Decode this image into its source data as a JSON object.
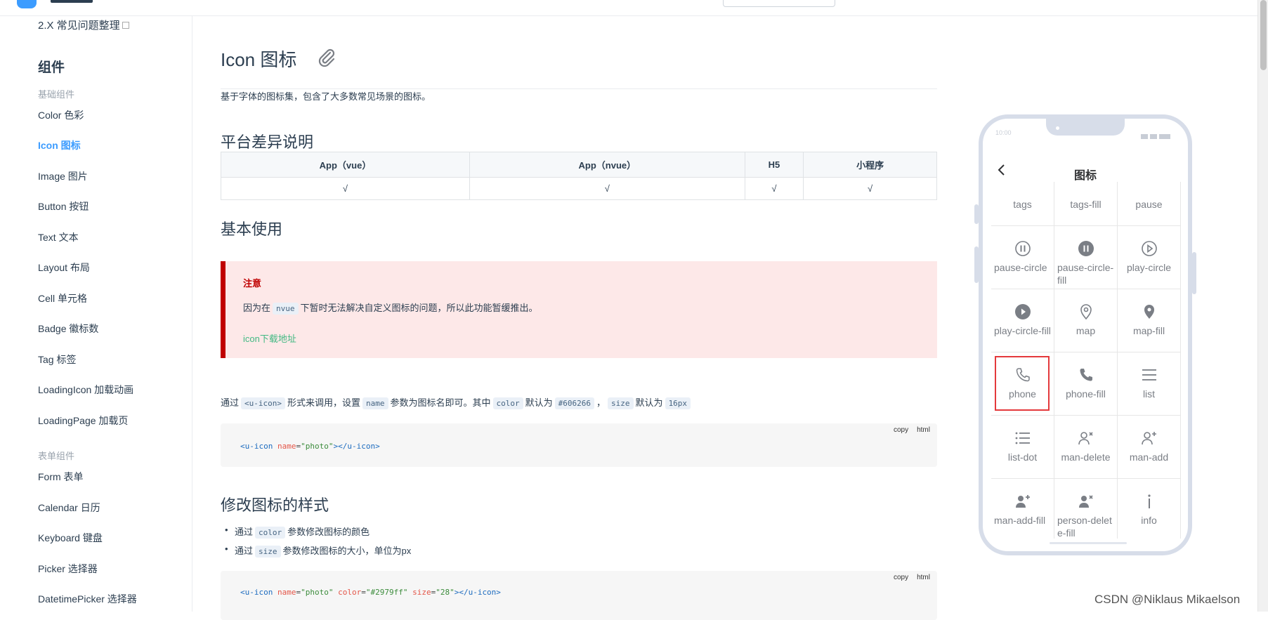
{
  "sidebar": {
    "top_link": "2.X 常见问题整理",
    "group_title": "组件",
    "sub_basic": "基础组件",
    "items_basic": [
      {
        "label": "Color 色彩"
      },
      {
        "label": "Icon 图标"
      },
      {
        "label": "Image 图片"
      },
      {
        "label": "Button 按钮"
      },
      {
        "label": "Text 文本"
      },
      {
        "label": "Layout 布局"
      },
      {
        "label": "Cell 单元格"
      },
      {
        "label": "Badge 徽标数"
      },
      {
        "label": "Tag 标签"
      },
      {
        "label": "LoadingIcon 加载动画"
      },
      {
        "label": "LoadingPage 加载页"
      }
    ],
    "sub_form": "表单组件",
    "items_form": [
      {
        "label": "Form 表单"
      },
      {
        "label": "Calendar 日历"
      },
      {
        "label": "Keyboard 键盘"
      },
      {
        "label": "Picker 选择器"
      },
      {
        "label": "DatetimePicker 选择器"
      }
    ],
    "active": "Icon 图标"
  },
  "main": {
    "title": "Icon 图标",
    "description": "基于字体的图标集，包含了大多数常见场景的图标。",
    "section_platform": "平台差异说明",
    "platform_table": {
      "headers": [
        "App（vue）",
        "App（nvue）",
        "H5",
        "小程序"
      ],
      "row": [
        "√",
        "√",
        "√",
        "√"
      ]
    },
    "section_basic": "基本使用",
    "warning": {
      "title": "注意",
      "text_before": "因为在",
      "code": "nvue",
      "text_after": "下暂时无法解决自定义图标的问题，所以此功能暂缓推出。",
      "link": "icon下载地址"
    },
    "usage": {
      "t1": "通过",
      "c1": "<u-icon>",
      "t2": "形式来调用，设置",
      "c2": "name",
      "t3": "参数为图标名即可。其中",
      "c3": "color",
      "t4": "默认为",
      "c4": "#606266",
      "t5": "，",
      "c5": "size",
      "t6": "默认为",
      "c6": "16px"
    },
    "code1": {
      "tag_open": "<u-icon",
      "attr1": "name",
      "val1": "\"photo\"",
      "tag_close": "></u-icon>"
    },
    "copy_label": "copy",
    "lang_label": "html",
    "section_style": "修改图标的样式",
    "tips": [
      {
        "t1": "通过",
        "code": "color",
        "t2": "参数修改图标的颜色"
      },
      {
        "t1": "通过",
        "code": "size",
        "t2": "参数修改图标的大小，单位为px"
      }
    ],
    "code2": {
      "tag_open": "<u-icon",
      "attr1": "name",
      "val1": "\"photo\"",
      "attr2": "color",
      "val2": "\"#2979ff\"",
      "attr3": "size",
      "val3": "\"28\"",
      "tag_close": "></u-icon>"
    }
  },
  "phone": {
    "time": "10:00",
    "title": "图标",
    "icons": [
      {
        "name": "tags",
        "icon": "tags-icon"
      },
      {
        "name": "tags-fill",
        "icon": "tags-fill-icon"
      },
      {
        "name": "pause",
        "icon": "pause-icon"
      },
      {
        "name": "pause-circle",
        "icon": "pause-circle-icon"
      },
      {
        "name": "pause-circle-fill",
        "icon": "pause-circle-fill-icon"
      },
      {
        "name": "play-circle",
        "icon": "play-circle-icon"
      },
      {
        "name": "play-circle-fill",
        "icon": "play-circle-fill-icon"
      },
      {
        "name": "map",
        "icon": "map-icon"
      },
      {
        "name": "map-fill",
        "icon": "map-fill-icon"
      },
      {
        "name": "phone",
        "icon": "phone-icon"
      },
      {
        "name": "phone-fill",
        "icon": "phone-fill-icon"
      },
      {
        "name": "list",
        "icon": "list-icon"
      },
      {
        "name": "list-dot",
        "icon": "list-dot-icon"
      },
      {
        "name": "man-delete",
        "icon": "man-delete-icon"
      },
      {
        "name": "man-add",
        "icon": "man-add-icon"
      },
      {
        "name": "man-add-fill",
        "icon": "man-add-fill-icon"
      },
      {
        "name": "person-delete-fill",
        "icon": "person-delete-fill-icon"
      },
      {
        "name": "info",
        "icon": "info-icon"
      }
    ],
    "highlighted": "phone"
  },
  "watermark": "CSDN @Niklaus Mikaelson",
  "colors": {
    "accent": "#3c9cff",
    "warn_border": "#c00000",
    "warn_bg": "#fde8e8",
    "link": "#42b983",
    "highlight": "#e4393c"
  }
}
